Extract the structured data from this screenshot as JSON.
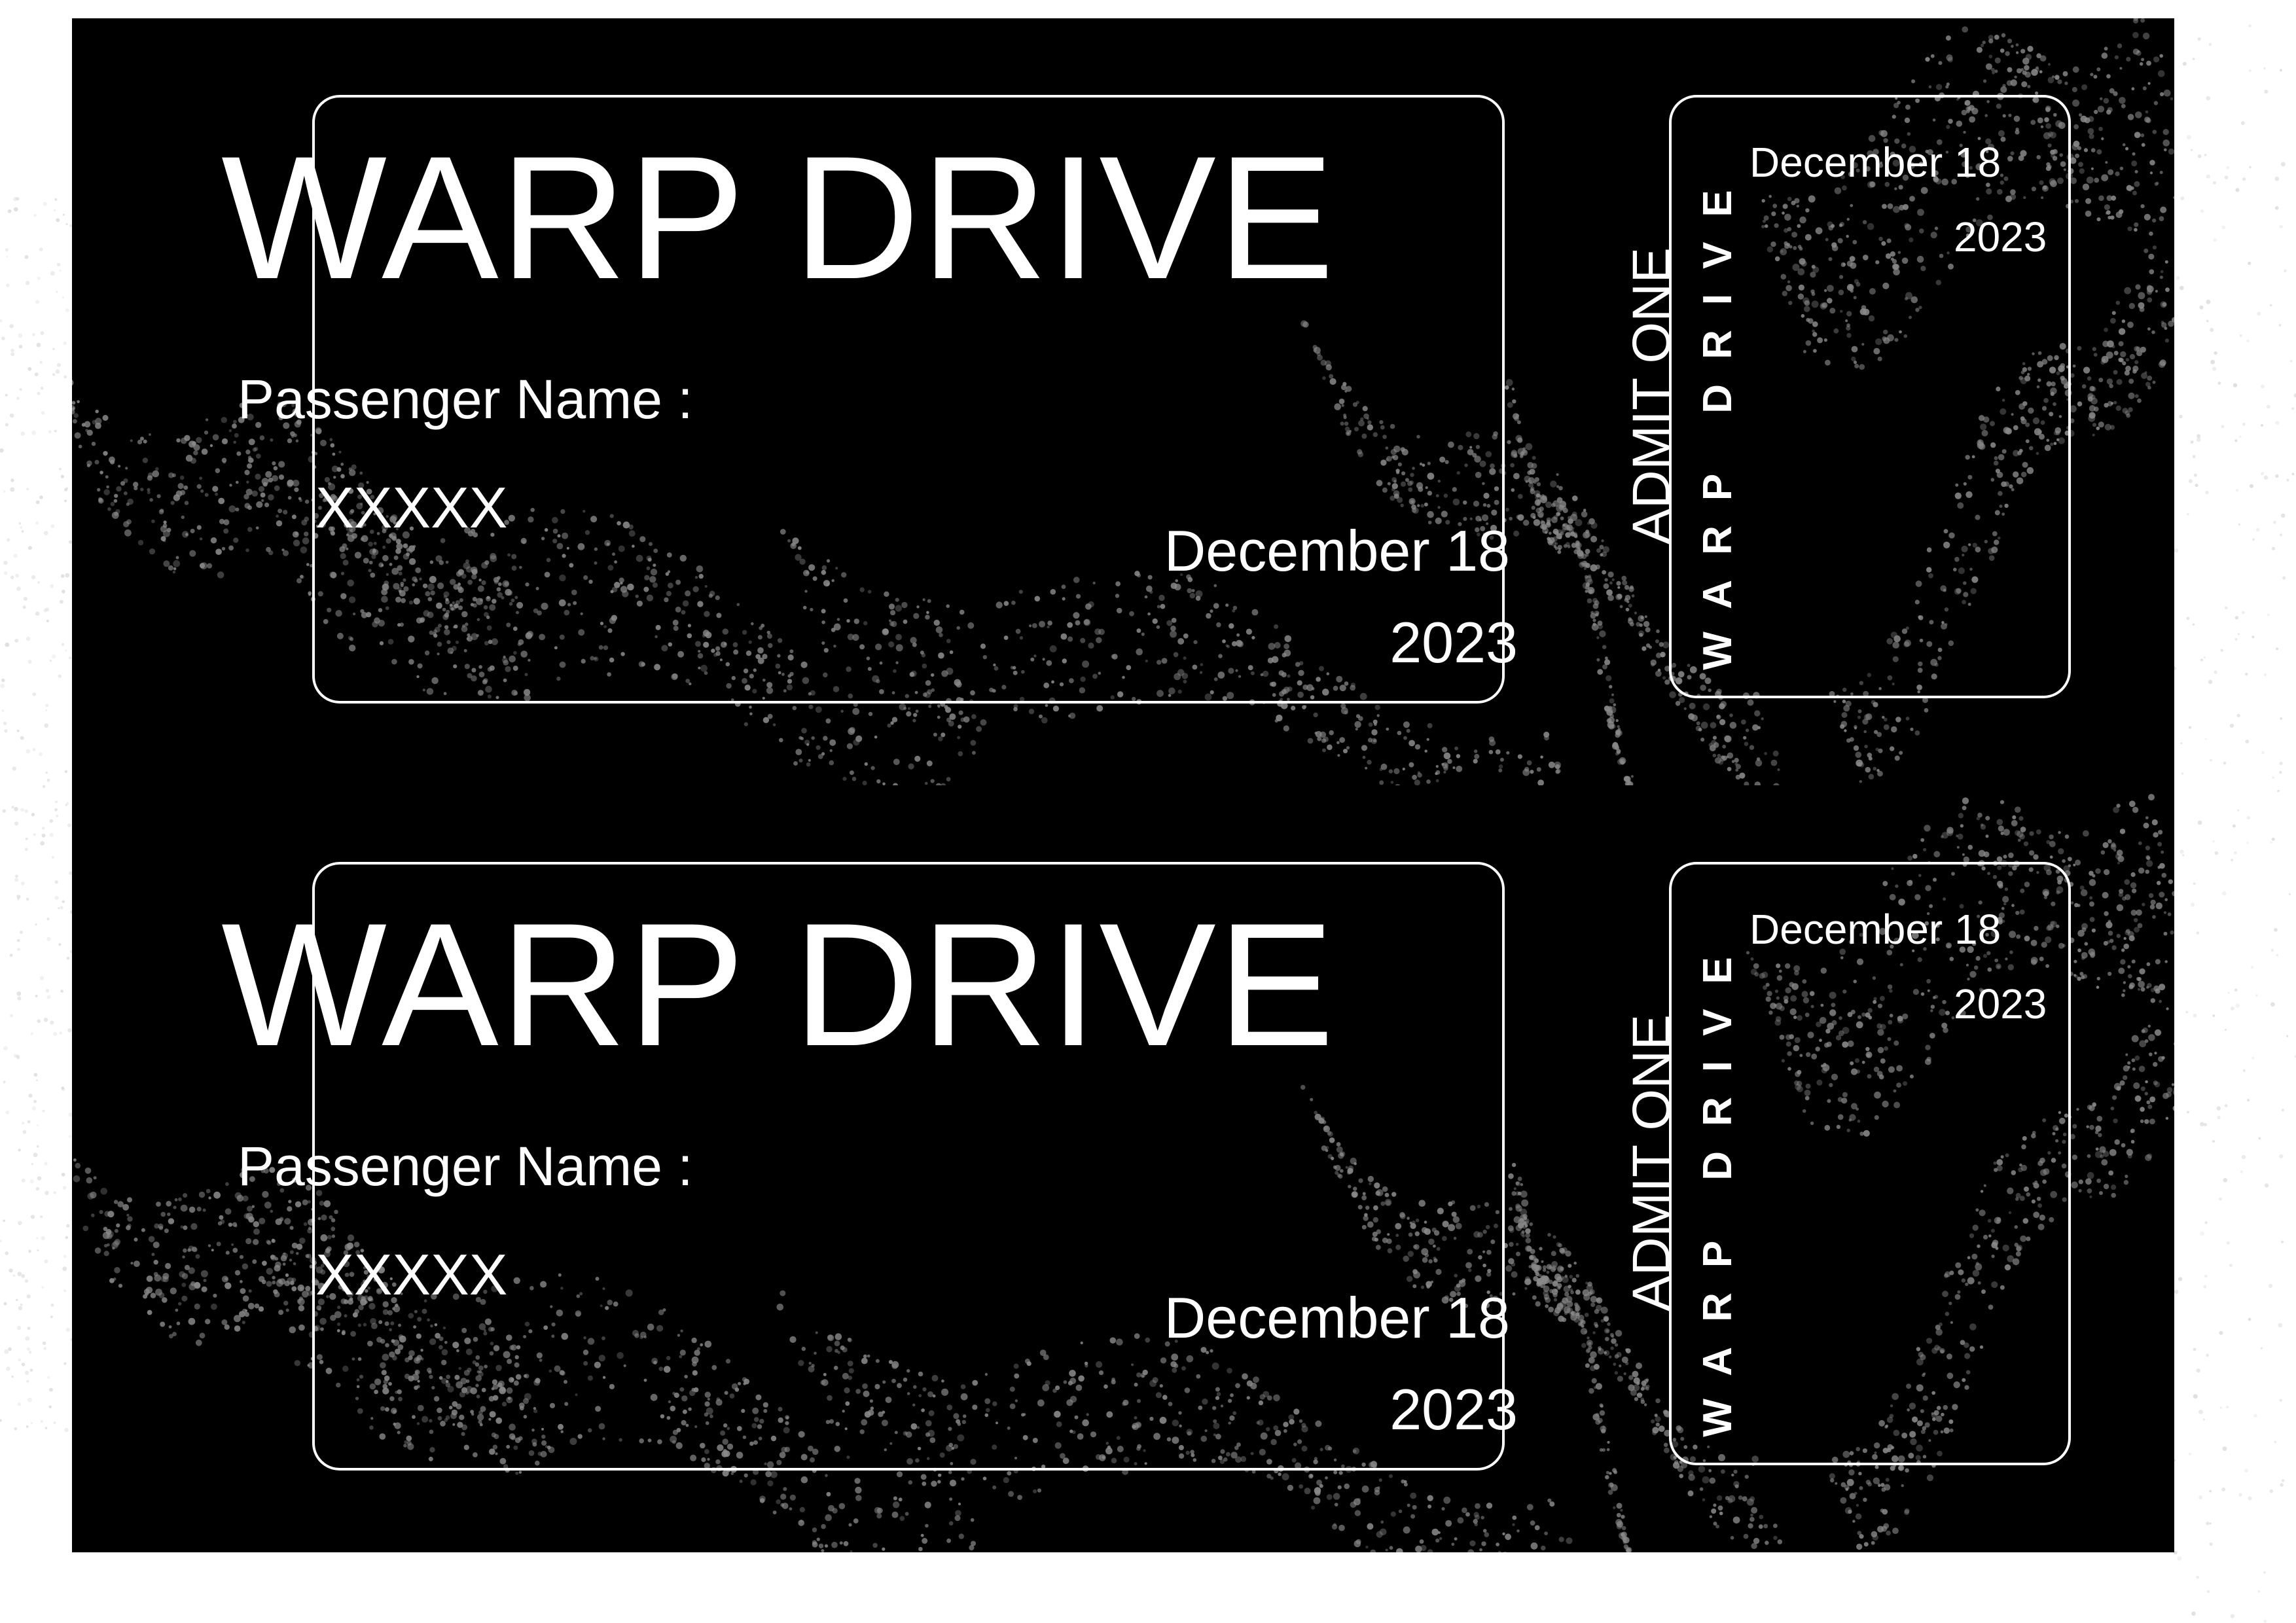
{
  "colors": {
    "ticket_background": "#000000",
    "text": "#ffffff",
    "pattern": "#8a8a8a",
    "page_background": "#ffffff"
  },
  "tickets": [
    {
      "title": "WARP DRIVE",
      "passenger_label": "Passenger Name :",
      "passenger_name": "XXXXX",
      "date": "December 18",
      "year": "2023",
      "stub": {
        "admit": "ADMIT ONE",
        "brand": "WARP DRIVE",
        "date": "December 18",
        "year": "2023"
      }
    },
    {
      "title": "WARP DRIVE",
      "passenger_label": "Passenger Name :",
      "passenger_name": "XXXXX",
      "date": "December 18",
      "year": "2023",
      "stub": {
        "admit": "ADMIT ONE",
        "brand": "WARP DRIVE",
        "date": "December 18",
        "year": "2023"
      }
    }
  ]
}
